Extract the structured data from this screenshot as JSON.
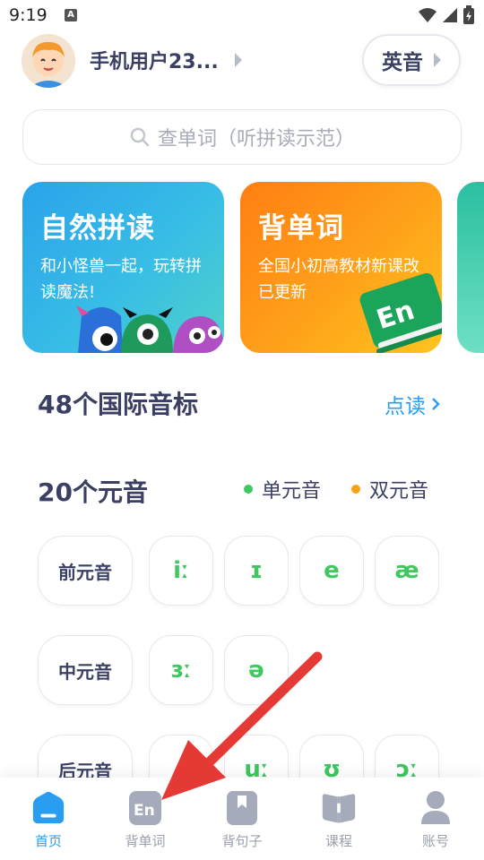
{
  "status_bar": {
    "time": "9:19",
    "notif_icon": "A"
  },
  "header": {
    "username": "手机用户23...",
    "accent_label": "英音"
  },
  "search": {
    "placeholder": "查单词（听拼读示范）"
  },
  "cards": [
    {
      "title": "自然拼读",
      "subtitle": "和小怪兽一起，玩转拼读魔法!"
    },
    {
      "title": "背单词",
      "subtitle": "全国小初高教材新课改已更新",
      "book_label": "En"
    }
  ],
  "ipa_section": {
    "title": "48个国际音标",
    "link_label": "点读"
  },
  "vowel_section": {
    "title": "20个元音",
    "legend": [
      {
        "label": "单元音",
        "color": "#3ec85f"
      },
      {
        "label": "双元音",
        "color": "#f7a21b"
      }
    ],
    "rows": [
      {
        "label": "前元音",
        "symbols": [
          "iː",
          "ɪ",
          "e",
          "æ"
        ]
      },
      {
        "label": "中元音",
        "symbols": [
          "ɜː",
          "ə"
        ]
      },
      {
        "label": "后元音",
        "symbols": [
          "",
          "uː",
          "ʊ",
          "ɔː"
        ]
      }
    ]
  },
  "bottom_nav": [
    {
      "label": "首页",
      "icon": "home-icon",
      "active": true
    },
    {
      "label": "背单词",
      "icon": "en-book-icon",
      "active": false,
      "icon_text": "En"
    },
    {
      "label": "背句子",
      "icon": "bookmark-icon",
      "active": false
    },
    {
      "label": "课程",
      "icon": "open-book-icon",
      "active": false
    },
    {
      "label": "账号",
      "icon": "account-icon",
      "active": false
    }
  ],
  "colors": {
    "accent_blue": "#2a9df1",
    "vowel_green": "#3ec85f",
    "diphthong_orange": "#f7a21b",
    "arrow_red": "#e53935"
  }
}
